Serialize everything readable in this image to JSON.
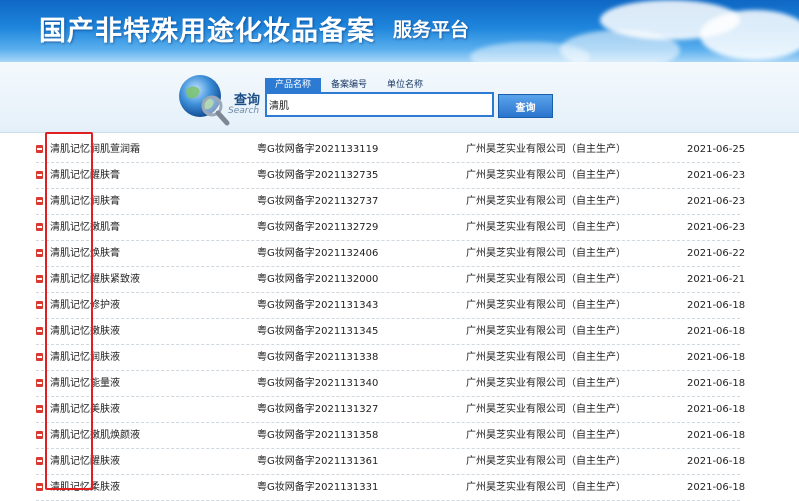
{
  "header": {
    "title": "国产非特殊用途化妆品备案",
    "subtitle": "服务平台",
    "colors": {
      "banner": "#1f86dc",
      "accent": "#2d7ad3",
      "highlight": "#e02020"
    }
  },
  "search": {
    "label_cn": "查询",
    "label_en": "Search",
    "logo_icon": "globe-magnifier-icon",
    "tabs": [
      {
        "label": "产品名称",
        "active": true
      },
      {
        "label": "备案编号",
        "active": false
      },
      {
        "label": "单位名称",
        "active": false
      }
    ],
    "query": "清肌",
    "button_label": "查询"
  },
  "results": [
    {
      "brand": "清肌记忆",
      "product": "润肌萱润霜",
      "number": "粤G妆网备字2021133119",
      "company": "广州昊芝实业有限公司（自主生产）",
      "date": "2021-06-25"
    },
    {
      "brand": "清肌记忆",
      "product": "醒肤膏",
      "number": "粤G妆网备字2021132735",
      "company": "广州昊芝实业有限公司（自主生产）",
      "date": "2021-06-23"
    },
    {
      "brand": "清肌记忆",
      "product": "润肤膏",
      "number": "粤G妆网备字2021132737",
      "company": "广州昊芝实业有限公司（自主生产）",
      "date": "2021-06-23"
    },
    {
      "brand": "清肌记忆",
      "product": "嫩肌膏",
      "number": "粤G妆网备字2021132729",
      "company": "广州昊芝实业有限公司（自主生产）",
      "date": "2021-06-23"
    },
    {
      "brand": "清肌记忆",
      "product": "焕肤膏",
      "number": "粤G妆网备字2021132406",
      "company": "广州昊芝实业有限公司（自主生产）",
      "date": "2021-06-22"
    },
    {
      "brand": "清肌记忆",
      "product": "醒肤紧致液",
      "number": "粤G妆网备字2021132000",
      "company": "广州昊芝实业有限公司（自主生产）",
      "date": "2021-06-21"
    },
    {
      "brand": "清肌记忆",
      "product": "修护液",
      "number": "粤G妆网备字2021131343",
      "company": "广州昊芝实业有限公司（自主生产）",
      "date": "2021-06-18"
    },
    {
      "brand": "清肌记忆",
      "product": "嫩肤液",
      "number": "粤G妆网备字2021131345",
      "company": "广州昊芝实业有限公司（自主生产）",
      "date": "2021-06-18"
    },
    {
      "brand": "清肌记忆",
      "product": "润肤液",
      "number": "粤G妆网备字2021131338",
      "company": "广州昊芝实业有限公司（自主生产）",
      "date": "2021-06-18"
    },
    {
      "brand": "清肌记忆",
      "product": "能量液",
      "number": "粤G妆网备字2021131340",
      "company": "广州昊芝实业有限公司（自主生产）",
      "date": "2021-06-18"
    },
    {
      "brand": "清肌记忆",
      "product": "美肤液",
      "number": "粤G妆网备字2021131327",
      "company": "广州昊芝实业有限公司（自主生产）",
      "date": "2021-06-18"
    },
    {
      "brand": "清肌记忆",
      "product": "嫩肌焕颜液",
      "number": "粤G妆网备字2021131358",
      "company": "广州昊芝实业有限公司（自主生产）",
      "date": "2021-06-18"
    },
    {
      "brand": "清肌记忆",
      "product": "醒肤液",
      "number": "粤G妆网备字2021131361",
      "company": "广州昊芝实业有限公司（自主生产）",
      "date": "2021-06-18"
    },
    {
      "brand": "清肌记忆",
      "product": "柔肤液",
      "number": "粤G妆网备字2021131331",
      "company": "广州昊芝实业有限公司（自主生产）",
      "date": "2021-06-18"
    }
  ]
}
